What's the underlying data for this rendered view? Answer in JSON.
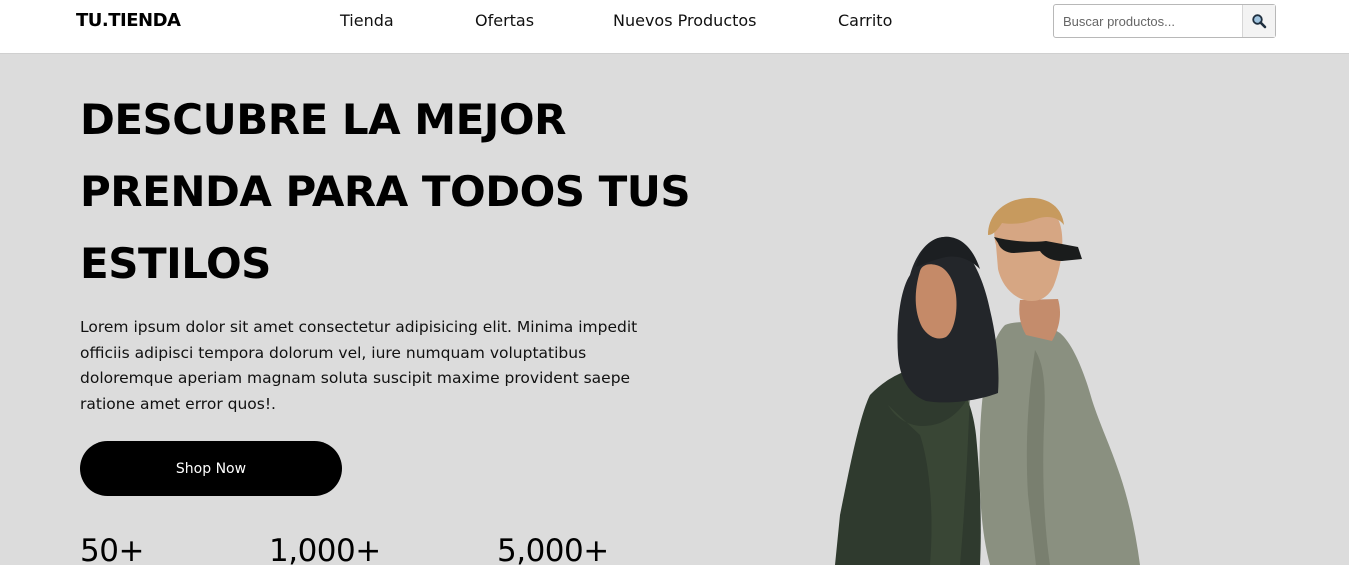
{
  "header": {
    "logo": "TU.TIENDA",
    "nav": [
      "Tienda",
      "Ofertas",
      "Nuevos Productos",
      "Carrito"
    ],
    "search": {
      "placeholder": "Buscar productos...",
      "icon": "search-icon"
    }
  },
  "hero": {
    "title": "DESCUBRE LA MEJOR PRENDA PARA TODOS TUS ESTILOS",
    "description": "Lorem ipsum dolor sit amet consectetur adipisicing elit. Minima impedit officiis adipisci tempora dolorum vel, iure numquam voluptatibus doloremque aperiam magnam soluta suscipit maxime provident saepe ratione amet error quos!.",
    "cta_label": "Shop Now",
    "stats": [
      "50+",
      "1,000+",
      "5,000+"
    ]
  },
  "colors": {
    "background": "#dcdcdc",
    "header": "#ffffff",
    "button": "#000000",
    "button_text": "#ffffff"
  }
}
